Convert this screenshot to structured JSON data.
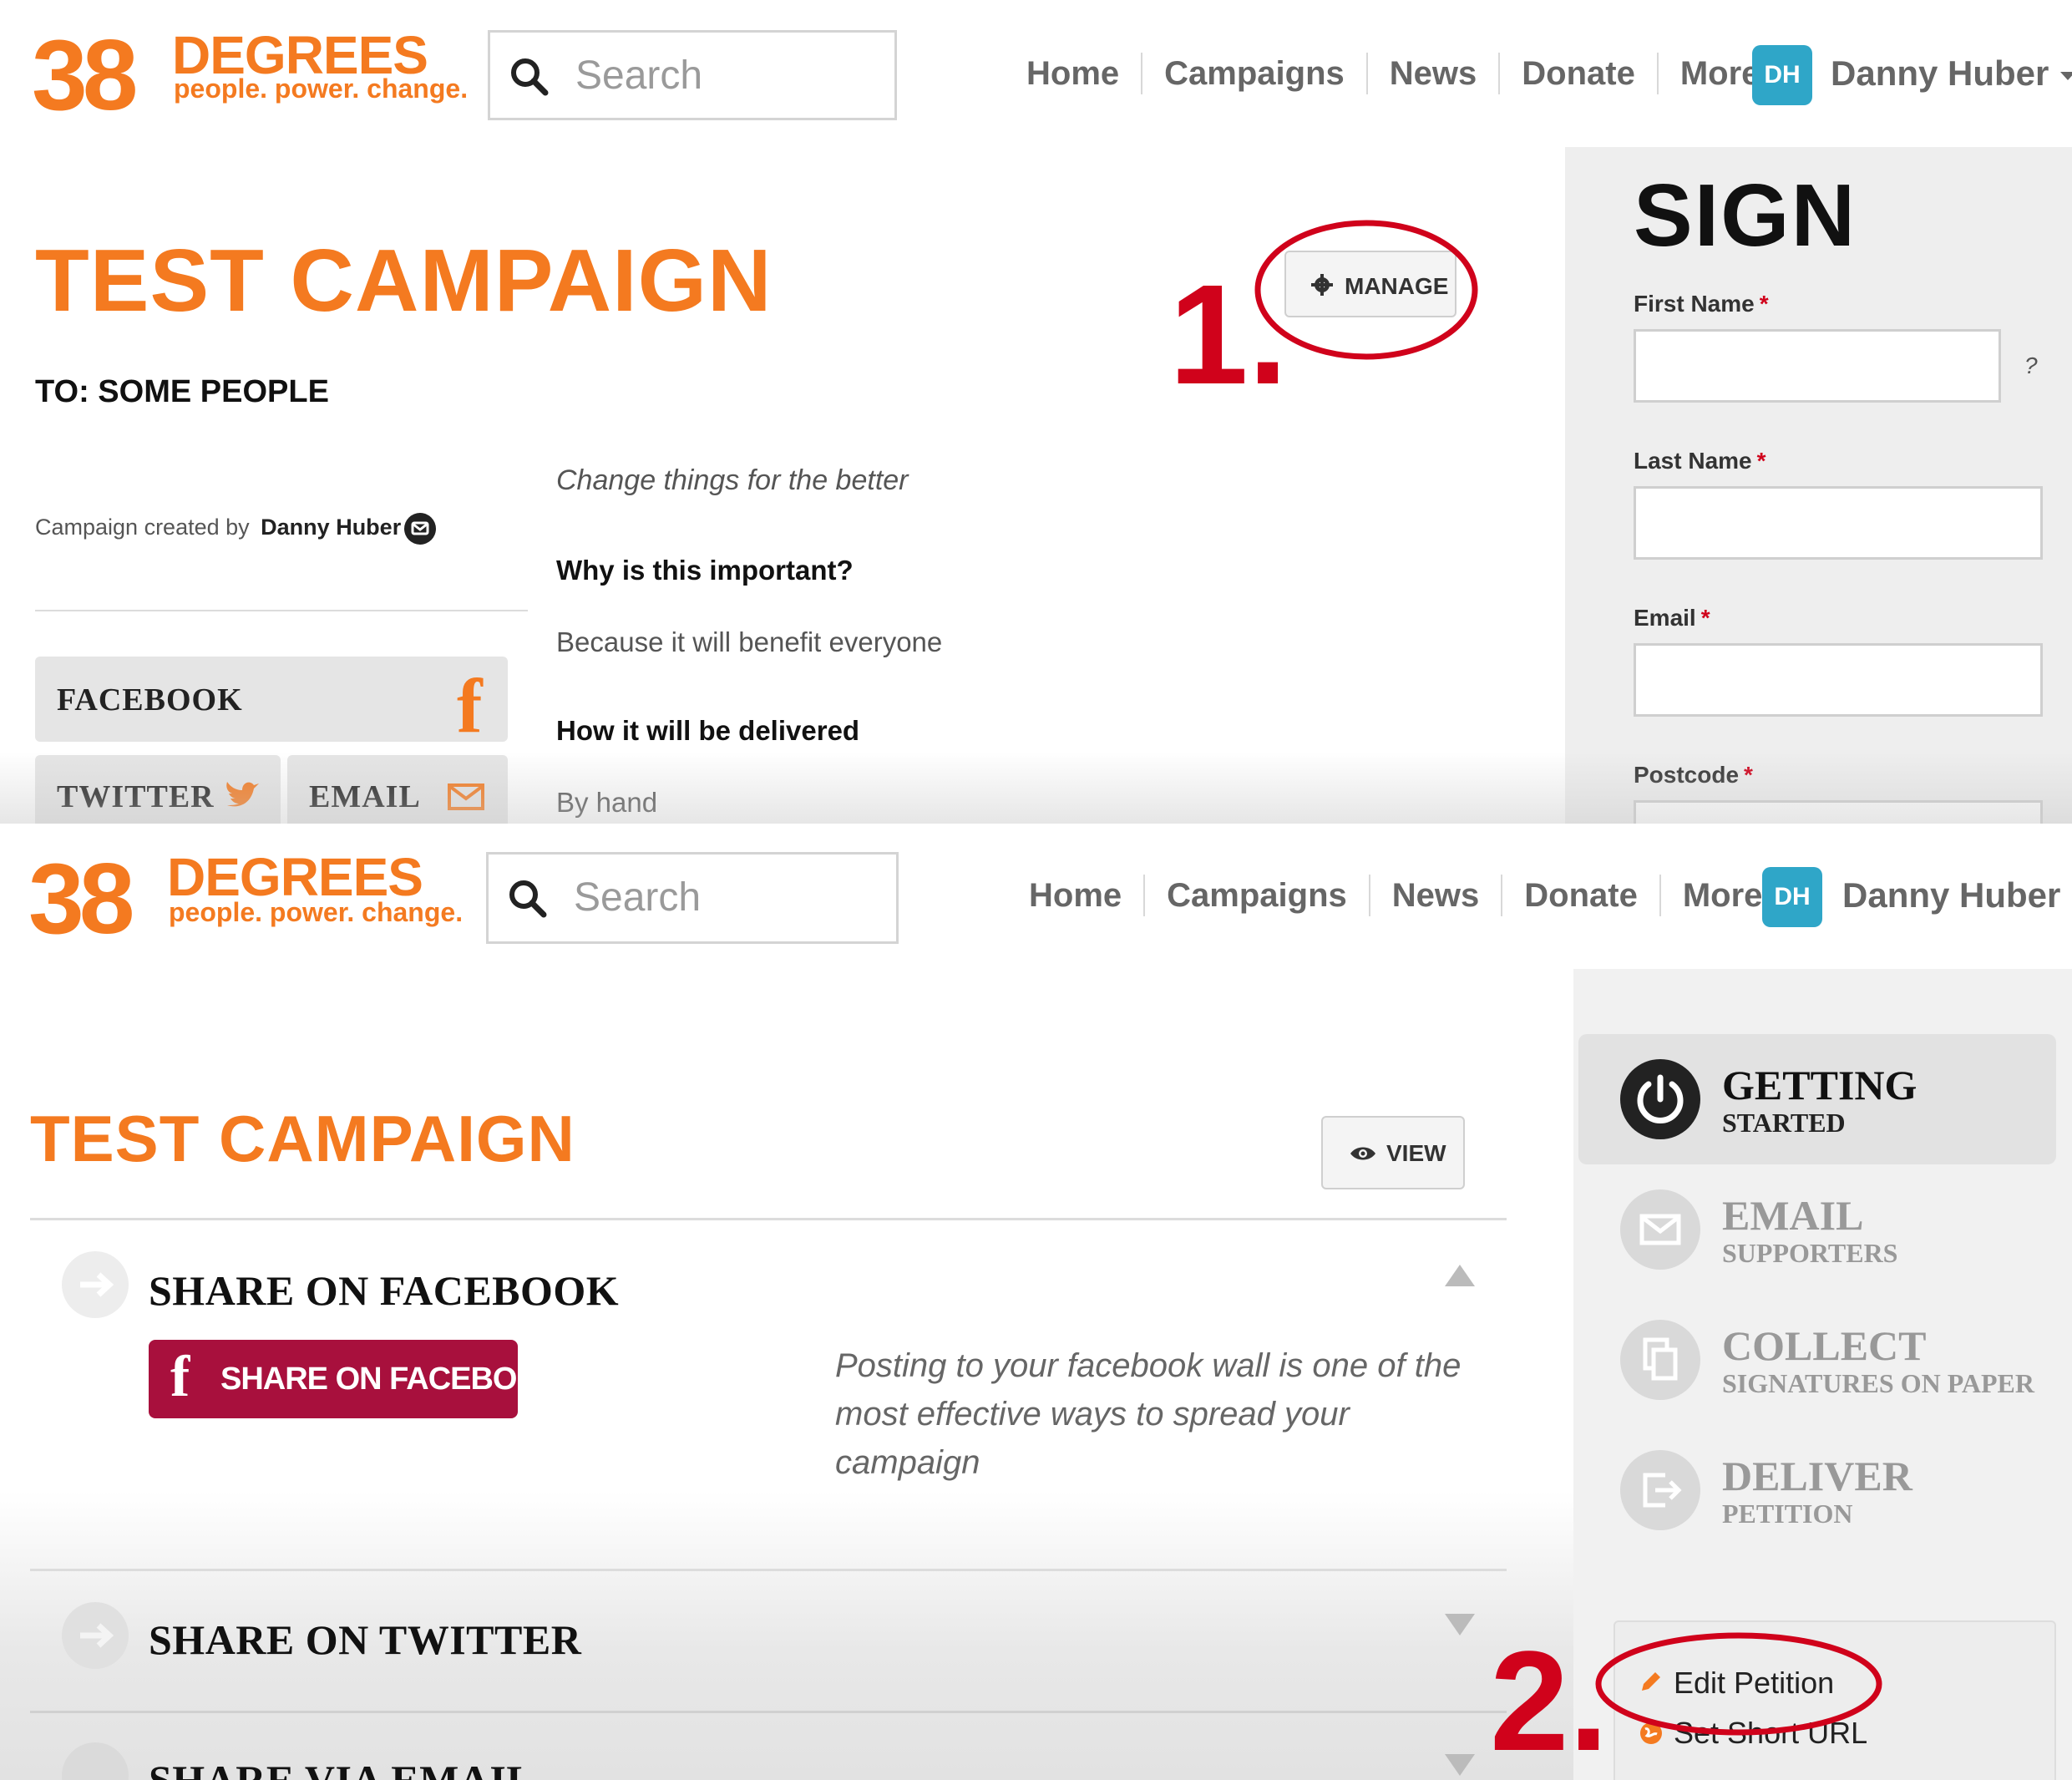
{
  "colors": {
    "brand_orange": "#f47a20",
    "annotation_red": "#d0021b",
    "facebook_button": "#a8103d",
    "avatar_blue": "#2fa6c8"
  },
  "header": {
    "logo_number": "38",
    "logo_word": "DEGREES",
    "logo_tagline": "people. power. change.",
    "search_placeholder": "Search",
    "nav": [
      "Home",
      "Campaigns",
      "News",
      "Donate",
      "More"
    ],
    "user_initials": "DH",
    "user_name": "Danny Huber"
  },
  "view_page": {
    "title": "TEST CAMPAIGN",
    "recipient": "TO: SOME PEOPLE",
    "created_by_prefix": "Campaign created by",
    "created_by_name": "Danny Huber",
    "manage_label": "MANAGE",
    "annotation": "1.",
    "summary": "Change things for the better",
    "why_heading": "Why is this important?",
    "why_text": "Because it will benefit everyone",
    "delivery_heading": "How it will be delivered",
    "delivery_text": "By hand",
    "share": {
      "facebook": "FACEBOOK",
      "twitter": "TWITTER",
      "email": "EMAIL"
    },
    "sign": {
      "title": "SIGN",
      "first_name": "First Name",
      "last_name": "Last Name",
      "email": "Email",
      "postcode": "Postcode",
      "required_mark": "*",
      "help": "?"
    }
  },
  "manage_page": {
    "title": "TEST CAMPAIGN",
    "view_label": "VIEW",
    "sections": {
      "facebook": "SHARE ON FACEBOOK",
      "twitter": "SHARE ON TWITTER",
      "email": "SHARE VIA EMAIL"
    },
    "facebook_button": "SHARE ON FACEBOOK",
    "facebook_tip": [
      "Posting to your facebook wall is one of the",
      "most effective ways to spread your",
      "campaign"
    ],
    "steps": [
      {
        "big": "GETTING",
        "small": "STARTED",
        "active": true
      },
      {
        "big": "EMAIL",
        "small": "SUPPORTERS",
        "active": false
      },
      {
        "big": "COLLECT",
        "small": "SIGNATURES ON PAPER",
        "active": false
      },
      {
        "big": "DELIVER",
        "small": "PETITION",
        "active": false
      }
    ],
    "edit_petition": "Edit Petition",
    "set_short_url": "Set Short URL",
    "annotation": "2."
  }
}
